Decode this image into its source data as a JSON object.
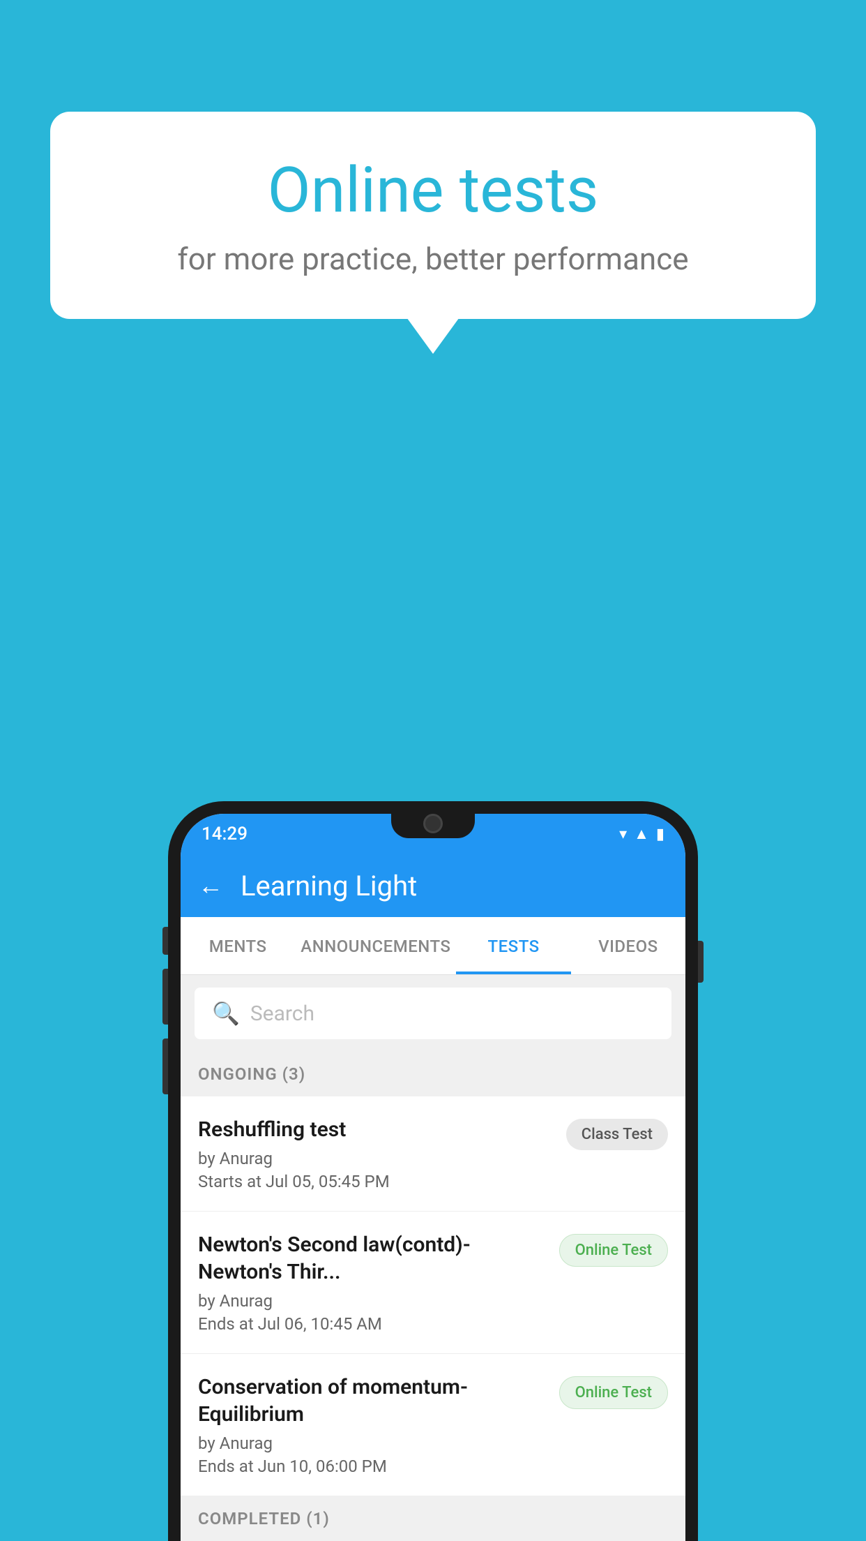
{
  "background_color": "#29b6d8",
  "speech_bubble": {
    "title": "Online tests",
    "subtitle": "for more practice, better performance"
  },
  "status_bar": {
    "time": "14:29",
    "icons": [
      "wifi",
      "signal",
      "battery"
    ]
  },
  "app_bar": {
    "title": "Learning Light",
    "back_label": "←"
  },
  "tabs": [
    {
      "label": "MENTS",
      "active": false
    },
    {
      "label": "ANNOUNCEMENTS",
      "active": false
    },
    {
      "label": "TESTS",
      "active": true
    },
    {
      "label": "VIDEOS",
      "active": false
    }
  ],
  "search": {
    "placeholder": "Search"
  },
  "sections": [
    {
      "header": "ONGOING (3)",
      "items": [
        {
          "name": "Reshuffling test",
          "author": "by Anurag",
          "time": "Starts at  Jul 05, 05:45 PM",
          "badge": "Class Test",
          "badge_type": "class"
        },
        {
          "name": "Newton's Second law(contd)-Newton's Thir...",
          "author": "by Anurag",
          "time": "Ends at  Jul 06, 10:45 AM",
          "badge": "Online Test",
          "badge_type": "online"
        },
        {
          "name": "Conservation of momentum-Equilibrium",
          "author": "by Anurag",
          "time": "Ends at  Jun 10, 06:00 PM",
          "badge": "Online Test",
          "badge_type": "online"
        }
      ]
    }
  ],
  "completed_header": "COMPLETED (1)"
}
